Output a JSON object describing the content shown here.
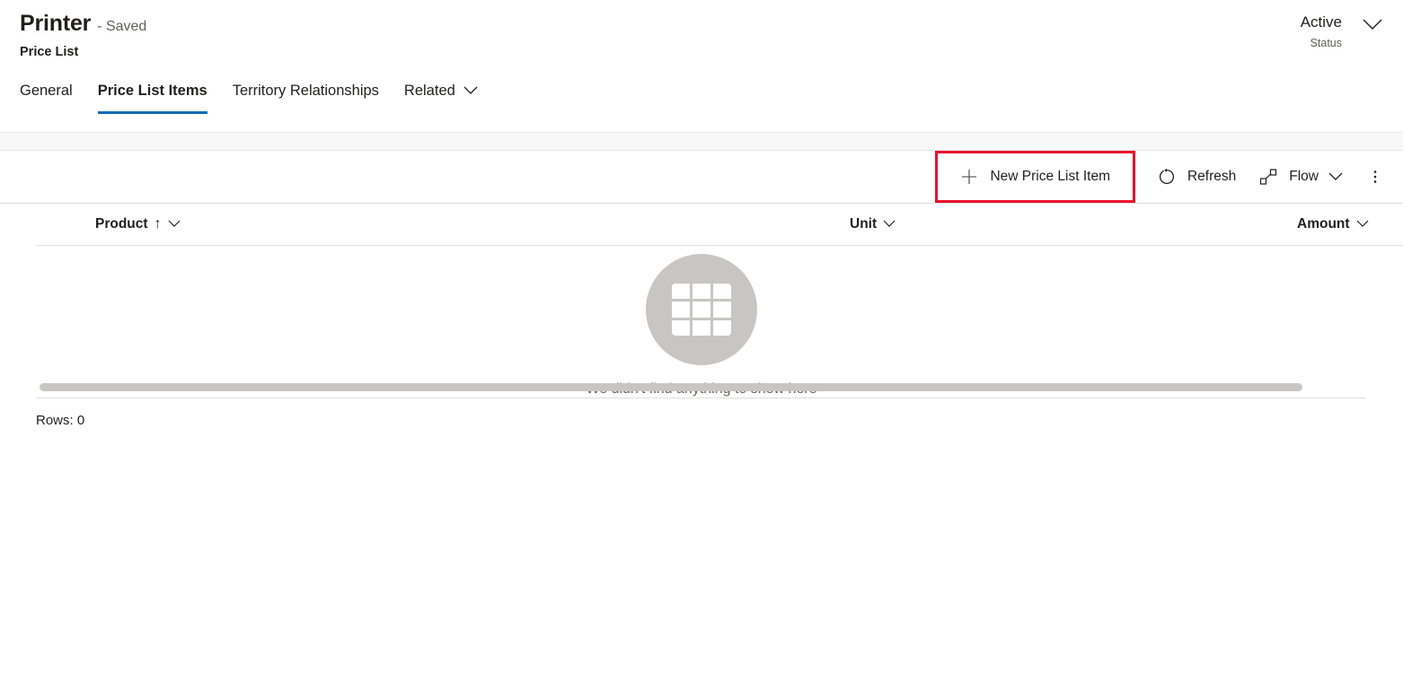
{
  "header": {
    "title": "Printer",
    "saved_state": "- Saved",
    "subtitle": "Price List",
    "status_value": "Active",
    "status_label": "Status",
    "status_chevron_icon": "chevron-down-icon"
  },
  "tabs": [
    {
      "label": "General",
      "selected": false,
      "has_chevron": false
    },
    {
      "label": "Price List Items",
      "selected": true,
      "has_chevron": false
    },
    {
      "label": "Territory Relationships",
      "selected": false,
      "has_chevron": false
    },
    {
      "label": "Related",
      "selected": false,
      "has_chevron": true
    }
  ],
  "command_bar": {
    "new_item_label": "New Price List Item",
    "new_item_icon": "plus-icon",
    "refresh_label": "Refresh",
    "refresh_icon": "refresh-icon",
    "flow_label": "Flow",
    "flow_icon": "flow-icon",
    "flow_chevron_icon": "chevron-down-icon",
    "overflow_icon": "more-vertical-icon",
    "highlight_color": "#e8112d"
  },
  "grid": {
    "columns": [
      {
        "label": "Product",
        "sort": "ascending",
        "sort_icon": "arrow-up-icon",
        "chevron_icon": "chevron-down-icon"
      },
      {
        "label": "Unit",
        "sort": "none",
        "chevron_icon": "chevron-down-icon"
      },
      {
        "label": "Amount",
        "sort": "none",
        "chevron_icon": "chevron-down-icon"
      }
    ],
    "rows": [],
    "empty_message": "We didn't find anything to show here",
    "empty_icon": "table-grid-icon",
    "rows_count_label": "Rows: 0"
  },
  "colors": {
    "accent": "#0f6cbd",
    "highlight": "#e8112d",
    "empty_circle": "#c8c6c4"
  }
}
